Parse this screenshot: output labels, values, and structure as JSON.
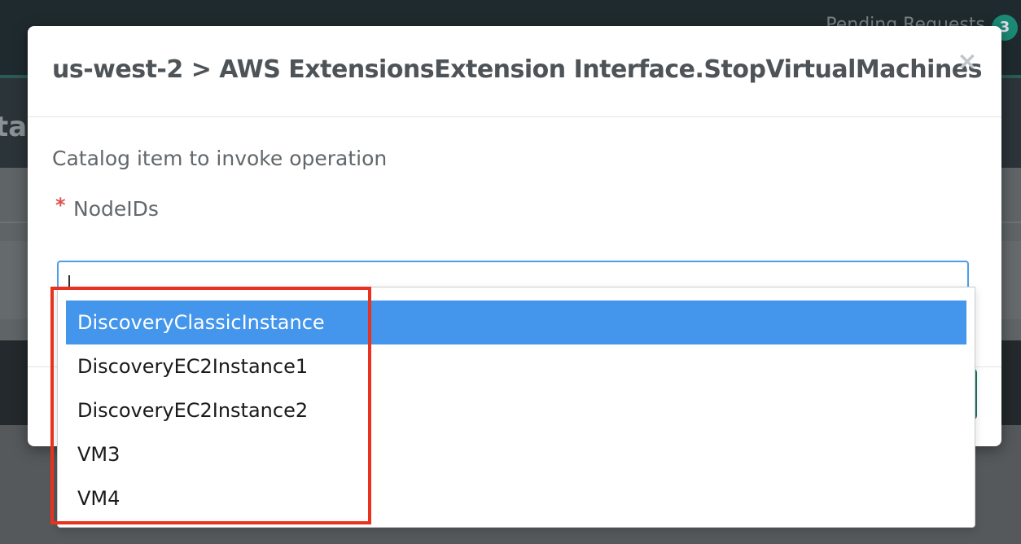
{
  "background": {
    "pending_requests_label": "Pending Requests",
    "pending_requests_count": "3",
    "page_heading_fragment": "tac"
  },
  "modal": {
    "title": "us-west-2 > AWS ExtensionsExtension Interface.StopVirtualMachines",
    "close_symbol": "×",
    "description": "Catalog item to invoke operation",
    "required_mark": "*",
    "field_label": "NodeIDs",
    "field_value": ""
  },
  "dropdown": {
    "options": [
      {
        "label": "DiscoveryClassicInstance",
        "selected": true
      },
      {
        "label": "DiscoveryEC2Instance1",
        "selected": false
      },
      {
        "label": "DiscoveryEC2Instance2",
        "selected": false
      },
      {
        "label": "VM3",
        "selected": false
      },
      {
        "label": "VM4",
        "selected": false
      }
    ]
  },
  "colors": {
    "highlight_border": "#e8321e",
    "selected_option": "#4396eb",
    "input_focus_border": "#4b9fe6"
  }
}
